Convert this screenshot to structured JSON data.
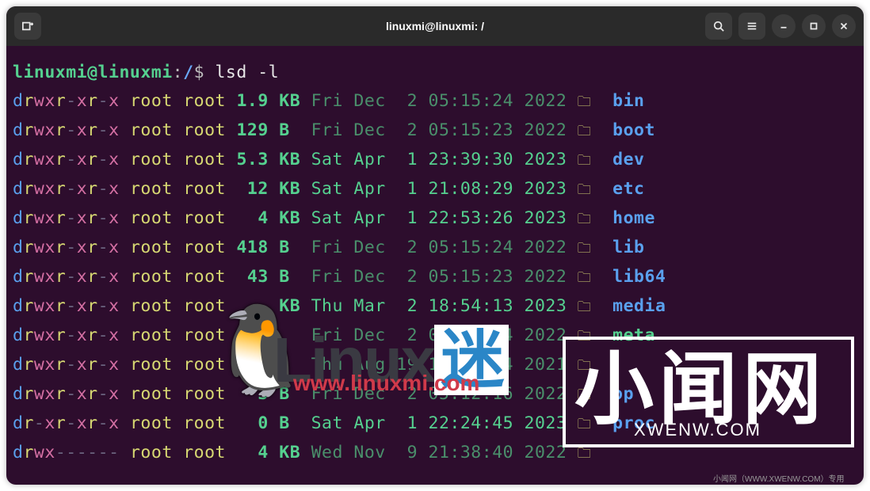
{
  "titlebar": {
    "title": "linuxmi@linuxmi: /"
  },
  "prompt": {
    "user": "linuxmi@linuxmi",
    "path": "/",
    "command": "lsd -l"
  },
  "rows": [
    {
      "perm": "drwxr-xr-x",
      "owner": "root",
      "group": "root",
      "size": "1.9",
      "unit": "KB",
      "day": "Fri",
      "mon": "Dec",
      "dnum": "2",
      "time": "05:15:24",
      "year": "2022",
      "name": "bin",
      "old": true
    },
    {
      "perm": "drwxr-xr-x",
      "owner": "root",
      "group": "root",
      "size": "129",
      "unit": "B",
      "day": "Fri",
      "mon": "Dec",
      "dnum": "2",
      "time": "05:15:23",
      "year": "2022",
      "name": "boot",
      "old": true
    },
    {
      "perm": "drwxr-xr-x",
      "owner": "root",
      "group": "root",
      "size": "5.3",
      "unit": "KB",
      "day": "Sat",
      "mon": "Apr",
      "dnum": "1",
      "time": "23:39:30",
      "year": "2023",
      "name": "dev",
      "old": false
    },
    {
      "perm": "drwxr-xr-x",
      "owner": "root",
      "group": "root",
      "size": "12",
      "unit": "KB",
      "day": "Sat",
      "mon": "Apr",
      "dnum": "1",
      "time": "21:08:29",
      "year": "2023",
      "name": "etc",
      "old": false
    },
    {
      "perm": "drwxr-xr-x",
      "owner": "root",
      "group": "root",
      "size": "4",
      "unit": "KB",
      "day": "Sat",
      "mon": "Apr",
      "dnum": "1",
      "time": "22:53:26",
      "year": "2023",
      "name": "home",
      "old": false
    },
    {
      "perm": "drwxr-xr-x",
      "owner": "root",
      "group": "root",
      "size": "418",
      "unit": "B",
      "day": "Fri",
      "mon": "Dec",
      "dnum": "2",
      "time": "05:15:24",
      "year": "2022",
      "name": "lib",
      "old": true
    },
    {
      "perm": "drwxr-xr-x",
      "owner": "root",
      "group": "root",
      "size": "43",
      "unit": "B",
      "day": "Fri",
      "mon": "Dec",
      "dnum": "2",
      "time": "05:15:23",
      "year": "2022",
      "name": "lib64",
      "old": true
    },
    {
      "perm": "drwxr-xr-x",
      "owner": "root",
      "group": "root",
      "size": "",
      "unit": "KB",
      "day": "Thu",
      "mon": "Mar",
      "dnum": "2",
      "time": "18:54:13",
      "year": "2023",
      "name": "media",
      "old": false
    },
    {
      "perm": "drwxr-xr-x",
      "owner": "root",
      "group": "root",
      "size": "",
      "unit": "",
      "day": "Fri",
      "mon": "Dec",
      "dnum": "2",
      "time": "05:15:24",
      "year": "2022",
      "name": "meta",
      "old": true,
      "green": true
    },
    {
      "perm": "drwxr-xr-x",
      "owner": "root",
      "group": "root",
      "size": "",
      "unit": "",
      "day": "Thu",
      "mon": "Aug",
      "dnum": "19",
      "time": "18:29:24",
      "year": "2021",
      "name": "",
      "old": true
    },
    {
      "perm": "drwxr-xr-x",
      "owner": "root",
      "group": "root",
      "size": "3",
      "unit": "B",
      "day": "Fri",
      "mon": "Dec",
      "dnum": "2",
      "time": "05:12:16",
      "year": "2022",
      "name": "op",
      "old": true
    },
    {
      "perm": "dr-xr-xr-x",
      "owner": "root",
      "group": "root",
      "size": "0",
      "unit": "B",
      "day": "Sat",
      "mon": "Apr",
      "dnum": "1",
      "time": "22:24:45",
      "year": "2023",
      "name": "proc",
      "old": false
    },
    {
      "perm": "drwx------",
      "owner": "root",
      "group": "root",
      "size": "4",
      "unit": "KB",
      "day": "Wed",
      "mon": "Nov",
      "dnum": "9",
      "time": "21:38:40",
      "year": "2022",
      "name": "",
      "old": true
    }
  ],
  "watermarks": {
    "linux_text": "Linux",
    "linux_mi": "迷",
    "linux_url": "www.linuxmi.com",
    "xwen_text": "小闻网",
    "xwen_url": "XWENW.COM",
    "xwen_small": "小闻网（WWW.XWENW.COM）专用"
  }
}
